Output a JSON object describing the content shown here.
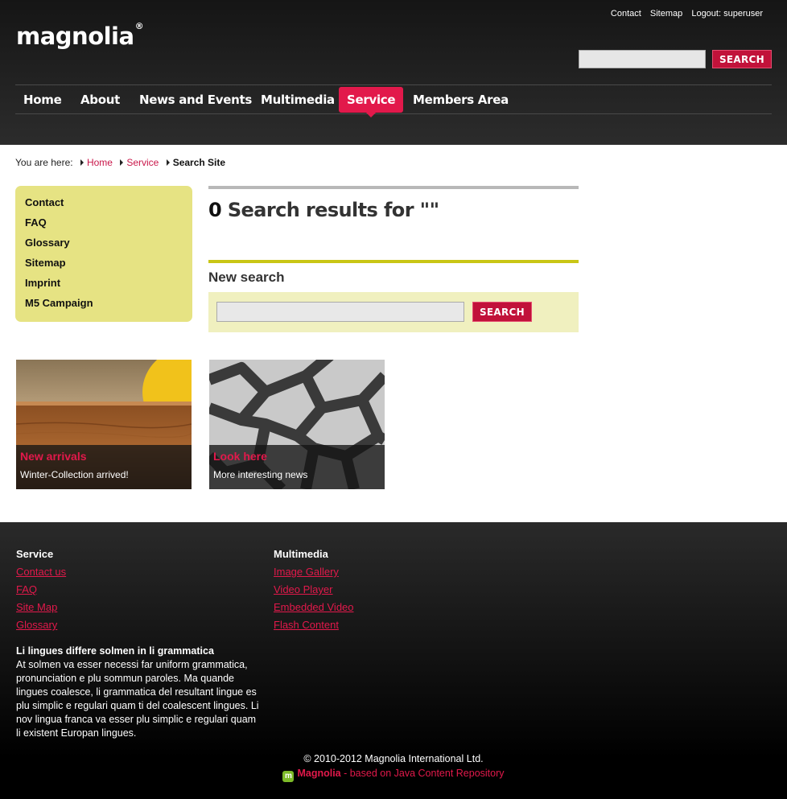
{
  "header": {
    "logo_text": "magnolia",
    "logo_mark": "®",
    "meta_links": [
      "Contact",
      "Sitemap",
      "Logout: superuser"
    ],
    "search": {
      "value": "",
      "button_label": "SEARCH"
    }
  },
  "nav": {
    "items": [
      {
        "label": "Home",
        "active": false
      },
      {
        "label": "About",
        "active": false
      },
      {
        "label": "News and Events",
        "active": false
      },
      {
        "label": "Multimedia",
        "active": false
      },
      {
        "label": "Service",
        "active": true
      },
      {
        "label": "Members Area",
        "active": false
      }
    ]
  },
  "breadcrumb": {
    "prefix": "You are here:",
    "items": [
      "Home",
      "Service"
    ],
    "current": "Search Site"
  },
  "sidebar": {
    "items": [
      "Contact",
      "FAQ",
      "Glossary",
      "Sitemap",
      "Imprint",
      "M5 Campaign"
    ]
  },
  "main": {
    "results_count": "0",
    "results_text": "Search results for \"\"",
    "new_search_title": "New search",
    "search_value": "",
    "search_button_label": "SEARCH"
  },
  "teasers": [
    {
      "title": "New arrivals",
      "text": "Winter-Collection arrived!"
    },
    {
      "title": "Look here",
      "text": "More interesting news"
    }
  ],
  "footer": {
    "columns": [
      {
        "heading": "Service",
        "links": [
          "Contact us",
          "FAQ",
          "Site Map",
          "Glossary"
        ]
      },
      {
        "heading": "Multimedia",
        "links": [
          "Image Gallery",
          "Video Player",
          "Embedded Video",
          "Flash Content"
        ]
      }
    ],
    "blurb_title": "Li lingues differe solmen in li grammatica",
    "blurb_text": "At solmen va esser necessi far uniform grammatica, pronunciation e plu sommun paroles. Ma quande lingues coalesce, li grammatica del resultant lingue es plu simplic e regulari quam ti del coalescent lingues. Li nov lingua franca va esser plu simplic e regulari quam li existent Europan lingues.",
    "copyright": "© 2010-2012 Magnolia International Ltd.",
    "powered_brand": "Magnolia",
    "powered_text": " - based on Java Content Repository"
  },
  "colors": {
    "accent": "#e2194b",
    "sidebar_bg": "#e6e383",
    "search_panel_bg": "#f0f0bf",
    "olive_rule": "#c9c616"
  },
  "icons": [
    "breadcrumb-arrow-icon",
    "magnolia-logo-icon"
  ]
}
